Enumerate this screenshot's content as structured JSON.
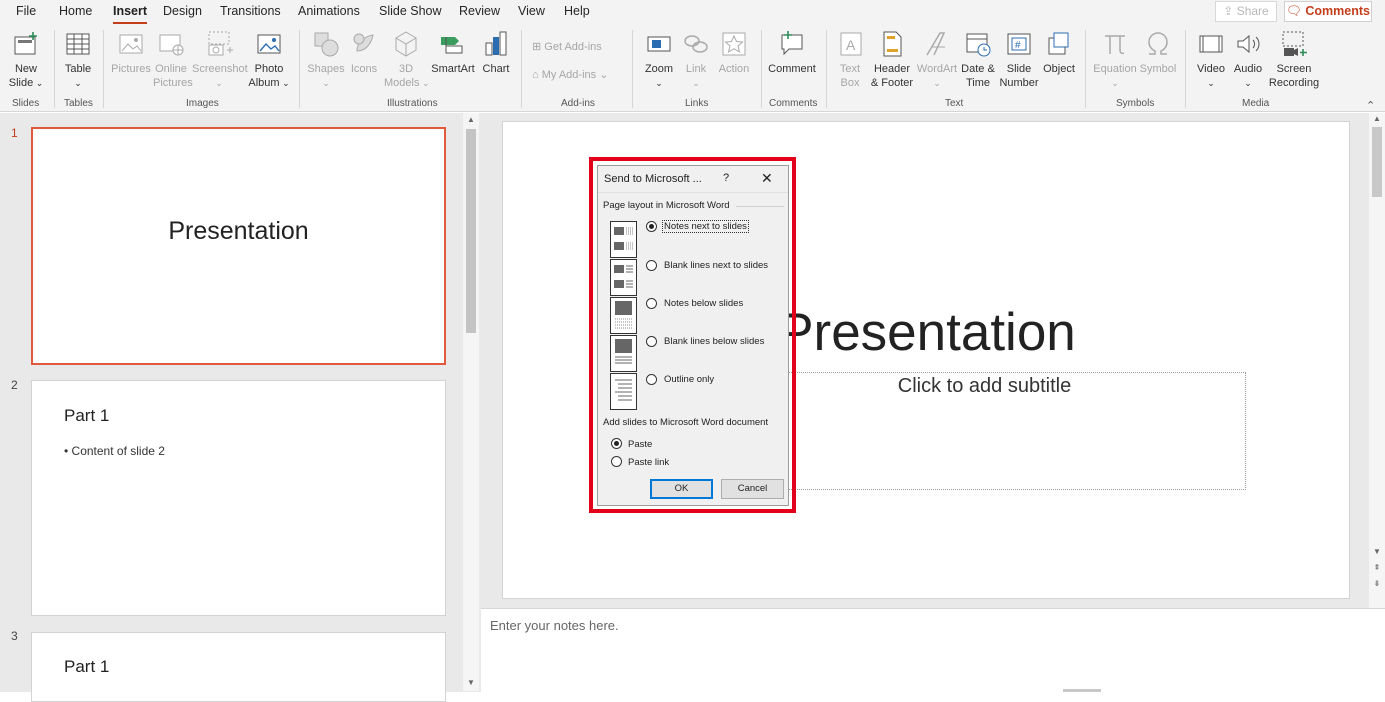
{
  "menubar": {
    "items": [
      "File",
      "Home",
      "Insert",
      "Design",
      "Transitions",
      "Animations",
      "Slide Show",
      "Review",
      "View",
      "Help"
    ],
    "active": "Insert",
    "share_label": "Share",
    "comments_label": "Comments"
  },
  "ribbon": {
    "groups": {
      "slides": "Slides",
      "tables": "Tables",
      "images": "Images",
      "illustrations": "Illustrations",
      "addins": "Add-ins",
      "links": "Links",
      "comments": "Comments",
      "text": "Text",
      "symbols": "Symbols",
      "media": "Media"
    },
    "buttons": {
      "new_slide": [
        "New",
        "Slide"
      ],
      "table": [
        "Table"
      ],
      "pictures": [
        "Pictures"
      ],
      "online_pictures": [
        "Online",
        "Pictures"
      ],
      "screenshot": [
        "Screenshot"
      ],
      "photo_album": [
        "Photo",
        "Album"
      ],
      "shapes": [
        "Shapes"
      ],
      "icons": [
        "Icons"
      ],
      "models_3d": [
        "3D",
        "Models"
      ],
      "smartart": [
        "SmartArt"
      ],
      "chart": [
        "Chart"
      ],
      "get_addins": "Get Add-ins",
      "my_addins": "My Add-ins",
      "zoom": [
        "Zoom"
      ],
      "link": [
        "Link"
      ],
      "action": [
        "Action"
      ],
      "comment": [
        "Comment"
      ],
      "text_box": [
        "Text",
        "Box"
      ],
      "header_footer": [
        "Header",
        "& Footer"
      ],
      "wordart": [
        "WordArt"
      ],
      "date_time": [
        "Date &",
        "Time"
      ],
      "slide_number": [
        "Slide",
        "Number"
      ],
      "object": [
        "Object"
      ],
      "equation": [
        "Equation"
      ],
      "symbol": [
        "Symbol"
      ],
      "video": [
        "Video"
      ],
      "audio": [
        "Audio"
      ],
      "screen_recording": [
        "Screen",
        "Recording"
      ]
    }
  },
  "slides_panel": {
    "thumbnails": [
      {
        "number": "1",
        "title": "Presentation",
        "bullet": ""
      },
      {
        "number": "2",
        "title": "Part 1",
        "bullet": "• Content of slide 2"
      },
      {
        "number": "3",
        "title": "Part 1",
        "bullet": ""
      }
    ]
  },
  "editor": {
    "slide_title": "Presentation",
    "subtitle_placeholder": "Click to add subtitle",
    "notes_placeholder": "Enter your notes here."
  },
  "dialog": {
    "title": "Send to Microsoft ...",
    "help": "?",
    "close": "✕",
    "page_layout_label": "Page layout in Microsoft Word",
    "layout_options": [
      {
        "label": "Notes next to slides",
        "selected": true
      },
      {
        "label": "Blank lines next to slides",
        "selected": false
      },
      {
        "label": "Notes below slides",
        "selected": false
      },
      {
        "label": "Blank lines below slides",
        "selected": false
      },
      {
        "label": "Outline only",
        "selected": false
      }
    ],
    "add_slides_label": "Add slides to Microsoft Word document",
    "add_options": [
      {
        "label": "Paste",
        "selected": true
      },
      {
        "label": "Paste link",
        "selected": false
      }
    ],
    "ok_label": "OK",
    "cancel_label": "Cancel"
  },
  "colors": {
    "accent": "#c43e1c",
    "highlight_box": "#e2001a",
    "selected_thumb_border": "#e1593a"
  }
}
